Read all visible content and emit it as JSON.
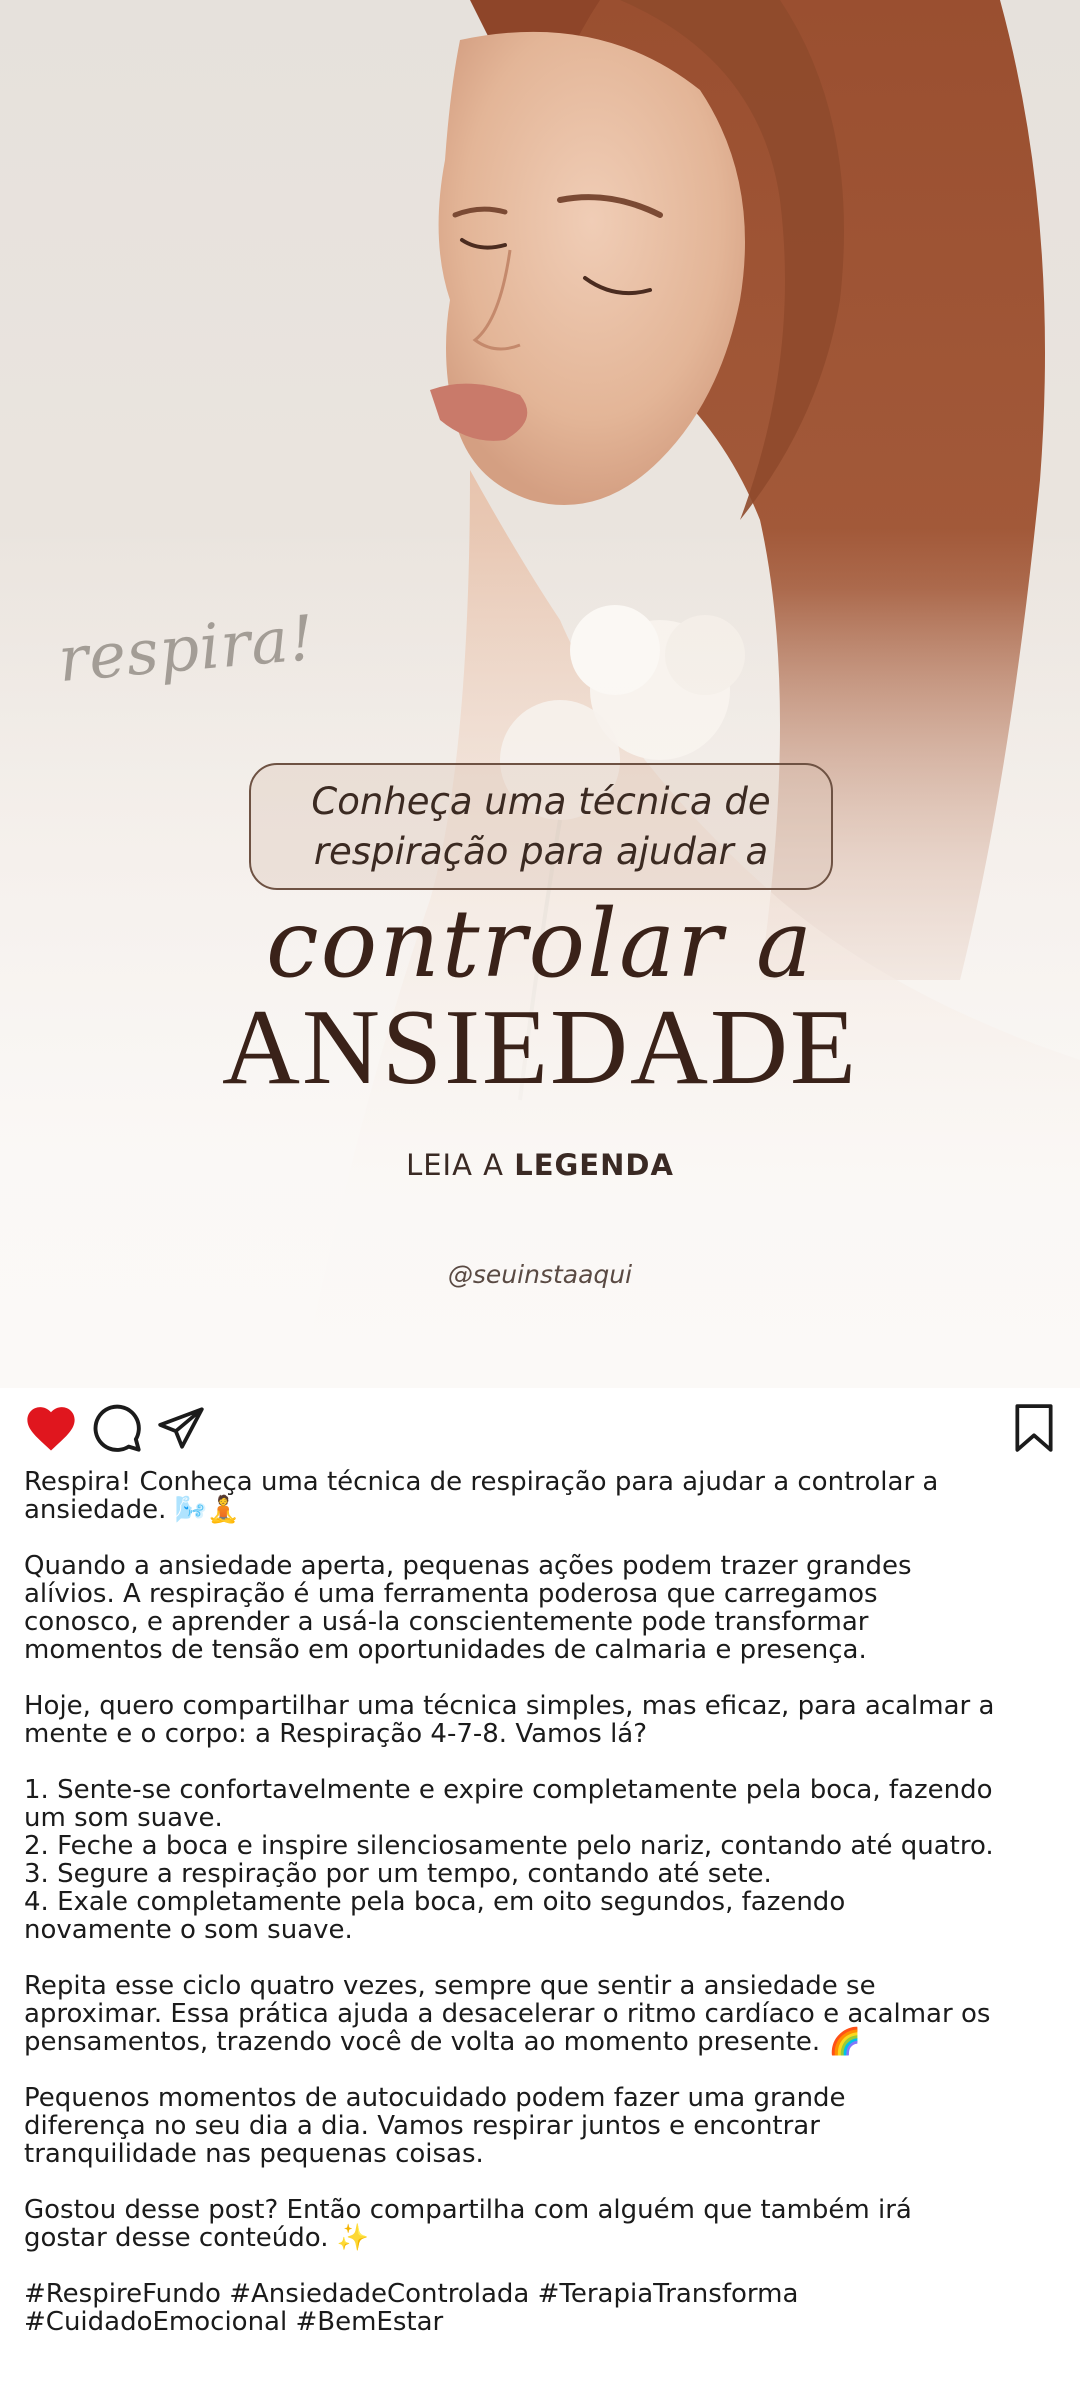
{
  "post": {
    "script_tag": "respira!",
    "headline_line1": "Conheça uma técnica de",
    "headline_line2": "respiração para ajudar a",
    "script_title": "controlar a",
    "big_title": "ANSIEDADE",
    "cta_prefix": "LEIA A",
    "cta_bold": "LEGENDA",
    "handle": "@seuinstaaqui"
  },
  "actions": {
    "like_icon": "heart-filled-icon",
    "comment_icon": "comment-bubble-icon",
    "share_icon": "paper-plane-icon",
    "save_icon": "bookmark-icon",
    "like_color": "#e0161e"
  },
  "caption": {
    "p1": [
      "Respira! Conheça uma técnica de respiração para ajudar a controlar a",
      "ansiedade. 🌬️🧘"
    ],
    "p2": [
      "Quando a ansiedade aperta, pequenas ações podem trazer grandes",
      "alívios. A respiração é uma ferramenta poderosa que carregamos",
      "conosco, e aprender a usá-la conscientemente pode transformar",
      "momentos de tensão em oportunidades de calmaria e presença."
    ],
    "p3": [
      "Hoje, quero compartilhar uma técnica simples, mas eficaz, para acalmar a",
      "mente e o corpo: a Respiração 4-7-8. Vamos lá?"
    ],
    "p4": [
      "1. Sente-se confortavelmente e expire completamente pela boca, fazendo",
      "um som suave.",
      "2. Feche a boca e inspire silenciosamente pelo nariz, contando até quatro.",
      "3. Segure a respiração por um tempo, contando até sete.",
      "4. Exale completamente pela boca, em oito segundos, fazendo",
      "novamente o som suave."
    ],
    "p5": [
      "Repita esse ciclo quatro vezes, sempre que sentir a ansiedade se",
      "aproximar. Essa prática ajuda a desacelerar o ritmo cardíaco e acalmar os",
      "pensamentos, trazendo você de volta ao momento presente. 🌈"
    ],
    "p6": [
      "Pequenos momentos de autocuidado podem fazer uma grande",
      "diferença no seu dia a dia. Vamos respirar juntos e encontrar",
      "tranquilidade nas pequenas coisas."
    ],
    "p7": [
      "Gostou desse post? Então compartilha com alguém que também irá",
      "gostar desse conteúdo. ✨"
    ],
    "p8": [
      "#RespireFundo #AnsiedadeControlada #TerapiaTransforma",
      "#CuidadoEmocional #BemEstar"
    ]
  }
}
